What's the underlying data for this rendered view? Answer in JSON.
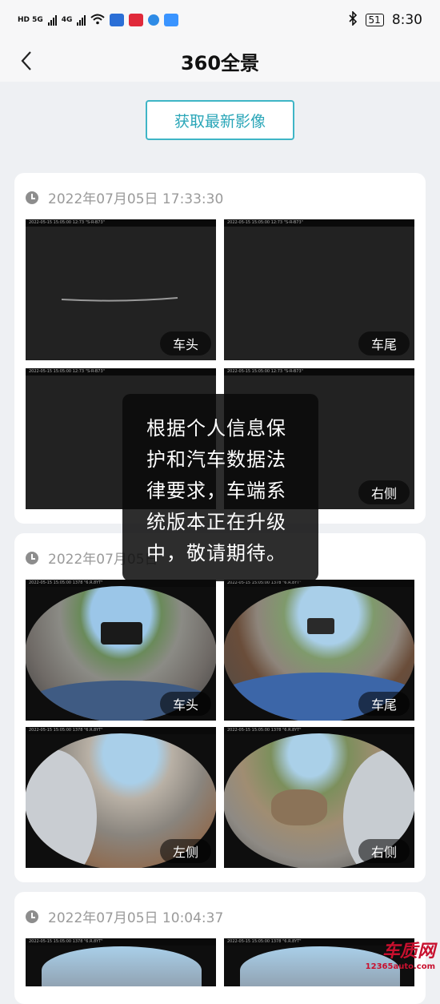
{
  "status_bar": {
    "time": "8:30",
    "battery": "51",
    "signal_labels": [
      "HD 5G",
      "4G"
    ],
    "icons": [
      "hd-signal-icon",
      "signal-5g-icon",
      "signal-4g-icon",
      "wifi-icon",
      "app-notify-icon",
      "app-notify-icon-2",
      "browser-icon",
      "cloud-icon",
      "bluetooth-icon",
      "battery-icon"
    ]
  },
  "nav": {
    "title": "360全景",
    "back_icon": "chevron-left-icon"
  },
  "fetch_button": {
    "label": "获取最新影像",
    "color": "#3fb5c6"
  },
  "snapshots": [
    {
      "time": "2022年07月05日 17:33:30",
      "images": [
        {
          "label": "车头",
          "view": "front-dark"
        },
        {
          "label": "车尾",
          "view": "rear-dark"
        },
        {
          "label": "",
          "view": "left-dark"
        },
        {
          "label": "右侧",
          "view": "right-dark"
        }
      ]
    },
    {
      "time": "2022年07月05日 ",
      "images": [
        {
          "label": "车头",
          "view": "front-street"
        },
        {
          "label": "车尾",
          "view": "rear-street"
        },
        {
          "label": "左侧",
          "view": "left-street"
        },
        {
          "label": "右侧",
          "view": "right-street"
        }
      ]
    },
    {
      "time": "2022年07月05日 10:04:37",
      "images": []
    }
  ],
  "toast": {
    "lines": [
      "根据个人信息保",
      "护和汽车数据法",
      "律要求，车端系",
      "统版本正在升级",
      "中，敬请期待。"
    ]
  },
  "watermark": {
    "logo": "车质网",
    "url": "12365auto.com"
  },
  "colors": {
    "accent": "#3fb5c6",
    "background": "#eef0f3",
    "card": "#ffffff"
  }
}
